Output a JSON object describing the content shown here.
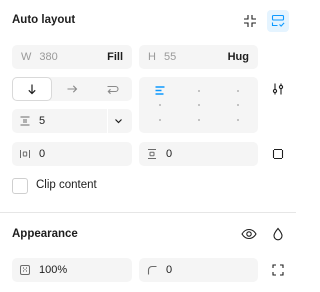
{
  "auto_layout": {
    "title": "Auto layout",
    "width": {
      "label": "W",
      "value": "380",
      "mode": "Fill"
    },
    "height": {
      "label": "H",
      "value": "55",
      "mode": "Hug"
    },
    "gap": {
      "value": "5"
    },
    "padding_horizontal": {
      "value": "0"
    },
    "padding_vertical": {
      "value": "0"
    },
    "clip_content_label": "Clip content",
    "clip_content_checked": false,
    "direction_selected": "vertical"
  },
  "appearance": {
    "title": "Appearance",
    "opacity": {
      "value": "100%"
    },
    "corner_radius": {
      "value": "0"
    }
  },
  "colors": {
    "accent": "#0d99ff",
    "field_bg": "#f5f5f5",
    "text": "#1e1e1e",
    "muted": "#9a9a9a"
  }
}
